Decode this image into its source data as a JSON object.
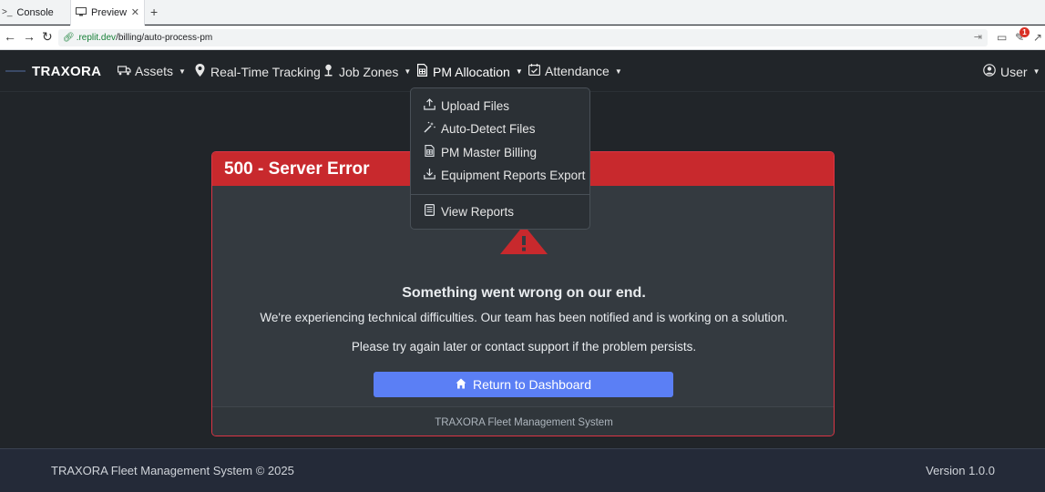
{
  "browser": {
    "tabs": [
      {
        "label": "Console",
        "icon": "terminal-icon"
      },
      {
        "label": "Preview",
        "icon": "monitor-icon"
      }
    ],
    "new_tab": "+",
    "url_domain": ".replit.dev",
    "url_path": "/billing/auto-process-pm",
    "notification_count": "1"
  },
  "navbar": {
    "brand": "TRAXORA",
    "items": [
      {
        "label": "Assets",
        "icon": "truck-icon"
      },
      {
        "label": "Real-Time Tracking",
        "icon": "map-pin-icon"
      },
      {
        "label": "Job Zones",
        "icon": "pushpin-icon"
      },
      {
        "label": "PM Allocation",
        "icon": "spreadsheet-icon"
      },
      {
        "label": "Attendance",
        "icon": "calendar-check-icon"
      }
    ],
    "user": "User"
  },
  "dropdown": {
    "items": [
      {
        "label": "Upload Files",
        "icon": "upload-icon"
      },
      {
        "label": "Auto-Detect Files",
        "icon": "magic-wand-icon"
      },
      {
        "label": "PM Master Billing",
        "icon": "spreadsheet-icon"
      },
      {
        "label": "Equipment Reports Export",
        "icon": "download-icon"
      },
      {
        "label": "View Reports",
        "icon": "document-icon"
      }
    ]
  },
  "error": {
    "title": "500 - Server Error",
    "heading": "Something went wrong on our end.",
    "message": "We're experiencing technical difficulties. Our team has been notified and is working on a solution.",
    "submessage": "Please try again later or contact support if the problem persists.",
    "button": "Return to Dashboard",
    "card_footer": "TRAXORA Fleet Management System"
  },
  "footer": {
    "left": "TRAXORA Fleet Management System © 2025",
    "right": "Version 1.0.0"
  },
  "colors": {
    "accent": "#5b7ff5",
    "danger": "#c8292d",
    "background": "#212529"
  }
}
